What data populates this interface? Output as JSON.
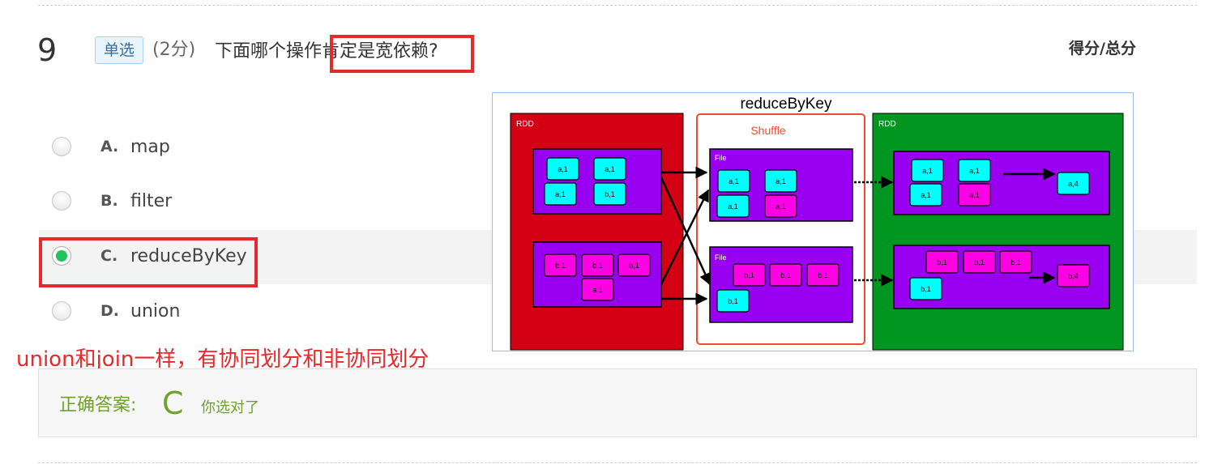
{
  "question": {
    "number": "9",
    "type": "单选",
    "score": "(2分)",
    "text": "下面哪个操作肯定是宽依赖?",
    "score_header": "得分/总分"
  },
  "options": [
    {
      "letter": "A.",
      "text": "map",
      "selected": false
    },
    {
      "letter": "B.",
      "text": "filter",
      "selected": false
    },
    {
      "letter": "C.",
      "text": "reduceByKey",
      "selected": true
    },
    {
      "letter": "D.",
      "text": "union",
      "selected": false
    }
  ],
  "note": "union和join一样，有协同划分和非协同划分",
  "answer": {
    "label": "正确答案:",
    "value": "C",
    "feedback": "你选对了"
  },
  "figure": {
    "title": "reduceByKey",
    "left_label": "RDD",
    "middle_label": "Shuffle",
    "right_label": "RDD",
    "file_label": "File",
    "colors": {
      "left_bg": "#d40014",
      "middle_border": "#f04c2e",
      "right_bg": "#00961f",
      "partition": "#9900f2",
      "cyan": "#00ffff",
      "magenta": "#ff00e5"
    },
    "left_top_cells": [
      "a,1",
      "a,1",
      "a,1",
      "b,1"
    ],
    "left_bottom_cells": [
      "b,1",
      "b,1",
      "b,1",
      "a,1"
    ],
    "mid_top_cells": [
      "a,1",
      "a,1",
      "a,1",
      "a,1"
    ],
    "mid_bottom_cells": [
      "b,1",
      "b,1",
      "b,1",
      "b,1"
    ],
    "right_top_cells": [
      "a,1",
      "a,1",
      "a,1",
      "a,1"
    ],
    "right_top_result": "a,4",
    "right_bottom_cells": [
      "b,1",
      "b,1",
      "b,1",
      "b,1"
    ],
    "right_bottom_result": "b,4"
  }
}
